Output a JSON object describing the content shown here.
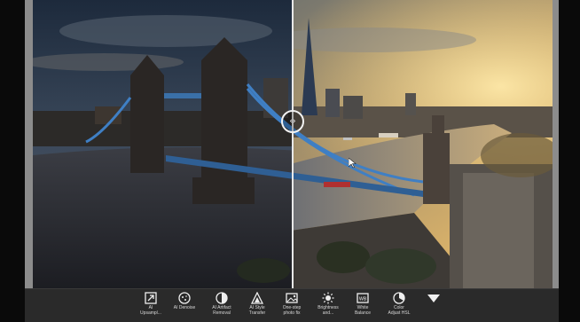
{
  "compare": {
    "handle_glyph": "‹›"
  },
  "toolbar": {
    "tools": [
      {
        "label": "AI\nUpsampl...",
        "icon": "upsample-icon"
      },
      {
        "label": "AI Denoise",
        "icon": "denoise-icon"
      },
      {
        "label": "AI Artifact\nRemoval",
        "icon": "artifact-removal-icon"
      },
      {
        "label": "AI Style\nTransfer",
        "icon": "style-transfer-icon"
      },
      {
        "label": "One-step\nphoto fix",
        "icon": "photo-fix-icon"
      },
      {
        "label": "Brightness\nand...",
        "icon": "brightness-icon"
      },
      {
        "label": "White\nBalance",
        "icon": "white-balance-icon"
      },
      {
        "label": "Color\nAdjust HSL",
        "icon": "color-hsl-icon"
      }
    ],
    "more_icon": "triangle-down-icon"
  }
}
